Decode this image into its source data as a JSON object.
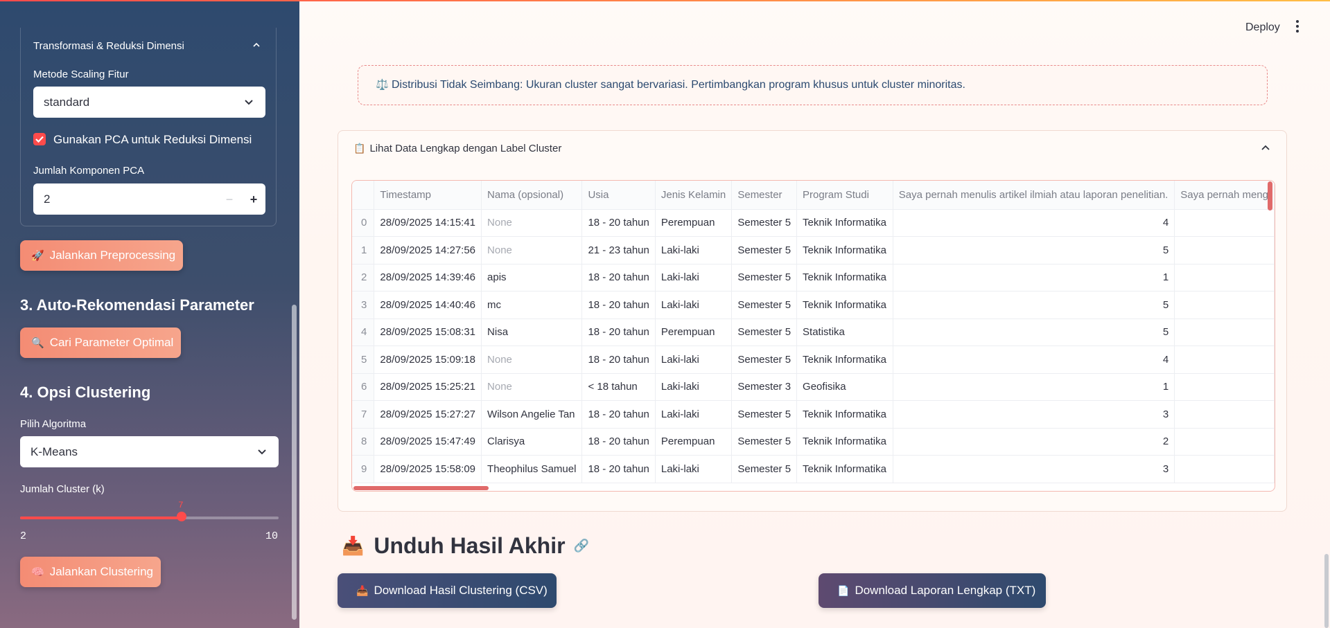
{
  "header": {
    "deploy_label": "Deploy"
  },
  "sidebar": {
    "expander_title": "Transformasi & Reduksi Dimensi",
    "scaling_label": "Metode Scaling Fitur",
    "scaling_value": "standard",
    "pca_checkbox_label": "Gunakan PCA untuk Reduksi Dimensi",
    "pca_checked": true,
    "pca_components_label": "Jumlah Komponen PCA",
    "pca_components_value": "2",
    "preprocess_button": "Jalankan Preprocessing",
    "section3_heading": "3. Auto-Rekomendasi Parameter",
    "find_params_button": "Cari Parameter Optimal",
    "section4_heading": "4. Opsi Clustering",
    "algorithm_label": "Pilih Algoritma",
    "algorithm_value": "K-Means",
    "k_label": "Jumlah Cluster (k)",
    "k_value": "7",
    "k_min": "2",
    "k_max": "10",
    "cluster_button": "Jalankan Clustering",
    "accent_color": "#ff4b4b"
  },
  "alert": {
    "icon": "scale-icon",
    "text": "Distribusi Tidak Seimbang: Ukuran cluster sangat bervariasi. Pertimbangkan program khusus untuk cluster minoritas."
  },
  "data_expander": {
    "title": "Lihat Data Lengkap dengan Label Cluster",
    "columns": [
      "",
      "Timestamp",
      "Nama (opsional)",
      "Usia",
      "Jenis Kelamin",
      "Semester",
      "Program Studi",
      "Saya pernah menulis artikel ilmiah atau laporan penelitian.",
      "Saya pernah meng"
    ],
    "rows": [
      [
        "0",
        "28/09/2025 14:15:41",
        "None",
        "18 - 20 tahun",
        "Perempuan",
        "Semester 5",
        "Teknik Informatika",
        "4",
        ""
      ],
      [
        "1",
        "28/09/2025 14:27:56",
        "None",
        "21 - 23 tahun",
        "Laki-laki",
        "Semester 5",
        "Teknik Informatika",
        "5",
        ""
      ],
      [
        "2",
        "28/09/2025 14:39:46",
        "apis",
        "18 - 20 tahun",
        "Laki-laki",
        "Semester 5",
        "Teknik Informatika",
        "1",
        ""
      ],
      [
        "3",
        "28/09/2025 14:40:46",
        "mc",
        "18 - 20 tahun",
        "Laki-laki",
        "Semester 5",
        "Teknik Informatika",
        "5",
        ""
      ],
      [
        "4",
        "28/09/2025 15:08:31",
        "Nisa",
        "18 - 20 tahun",
        "Perempuan",
        "Semester 5",
        "Statistika",
        "5",
        ""
      ],
      [
        "5",
        "28/09/2025 15:09:18",
        "None",
        "18 - 20 tahun",
        "Laki-laki",
        "Semester 5",
        "Teknik Informatika",
        "4",
        ""
      ],
      [
        "6",
        "28/09/2025 15:25:21",
        "None",
        "< 18 tahun",
        "Laki-laki",
        "Semester 3",
        "Geofisika",
        "1",
        ""
      ],
      [
        "7",
        "28/09/2025 15:27:27",
        "Wilson Angelie Tan",
        "18 - 20 tahun",
        "Laki-laki",
        "Semester 5",
        "Teknik Informatika",
        "3",
        ""
      ],
      [
        "8",
        "28/09/2025 15:47:49",
        "Clarisya",
        "18 - 20 tahun",
        "Perempuan",
        "Semester 5",
        "Teknik Informatika",
        "2",
        ""
      ],
      [
        "9",
        "28/09/2025 15:58:09",
        "Theophilus Samuel",
        "18 - 20 tahun",
        "Laki-laki",
        "Semester 5",
        "Teknik Informatika",
        "3",
        ""
      ]
    ]
  },
  "download": {
    "heading": "Unduh Hasil Akhir",
    "csv_button": "Download Hasil Clustering (CSV)",
    "txt_button": "Download Laporan Lengkap (TXT)"
  }
}
